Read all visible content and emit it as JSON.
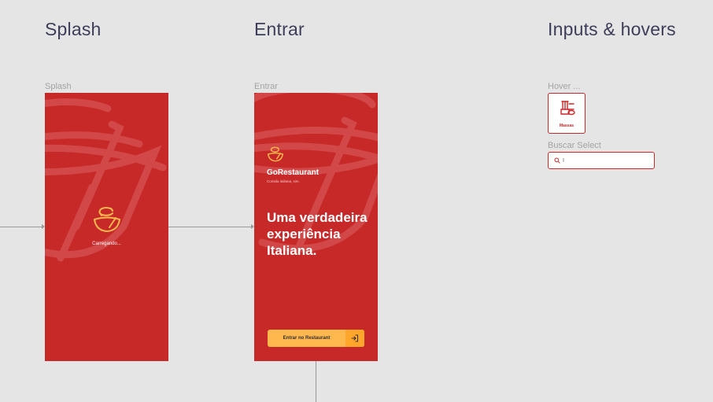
{
  "sections": {
    "splash_title": "Splash",
    "entrar_title": "Entrar",
    "inputs_title": "Inputs & hovers"
  },
  "frames": {
    "splash_label": "Splash",
    "entrar_label": "Entrar",
    "hover_label": "Hover ...",
    "buscar_label": "Buscar Select"
  },
  "splash": {
    "loading_text": "Carregando..."
  },
  "entrar": {
    "brand_name": "GoRestaurant",
    "brand_tagline": "Comida italiana, sim.",
    "headline": "Uma verdadeira experiência Italiana.",
    "button_label": "Entrar no Restaurant"
  },
  "hover_card": {
    "label": "Massas"
  },
  "search": {
    "value": "I"
  },
  "colors": {
    "brand_red": "#c72828",
    "accent_yellow": "#ffb84d",
    "accent_yellow_dark": "#ffa62b",
    "canvas_bg": "#e5e5e5",
    "title_text": "#3d3f5a"
  },
  "icons": {
    "logo": "bowl-logo-icon",
    "login": "log-in-icon",
    "pasta": "pasta-icon",
    "search": "search-icon"
  }
}
